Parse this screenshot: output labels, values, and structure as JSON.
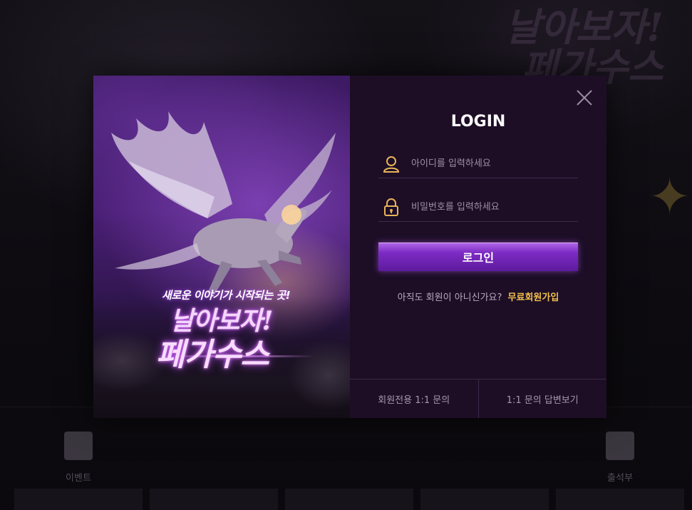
{
  "background": {
    "title_line_1": "날아보자!",
    "title_line_2": "페가수스",
    "menu": [
      {
        "label": "이벤트",
        "icon": "gift-icon"
      },
      {
        "label": "출석부",
        "icon": "calendar-check-icon"
      }
    ]
  },
  "promo": {
    "tagline": "새로운 이야기가 시작되는 곳!",
    "title_line_1": "날아보자!",
    "title_line_2": "페가수스"
  },
  "login": {
    "title": "LOGIN",
    "id_placeholder": "아이디를 입력하세요",
    "id_value": "",
    "password_placeholder": "비밀번호를 입력하세요",
    "password_value": "",
    "submit_label": "로그인",
    "signup_prompt": "아직도 회원이 아니신가요?",
    "signup_link": "무료회원가입",
    "close_icon": "close-icon",
    "user_icon": "user-icon",
    "lock_icon": "lock-icon",
    "accent_color": "#f2c14a",
    "button_color": "#7d2bc4"
  },
  "footer": {
    "inquiry_label": "회원전용 1:1 문의",
    "answers_label": "1:1 문의 답변보기"
  }
}
